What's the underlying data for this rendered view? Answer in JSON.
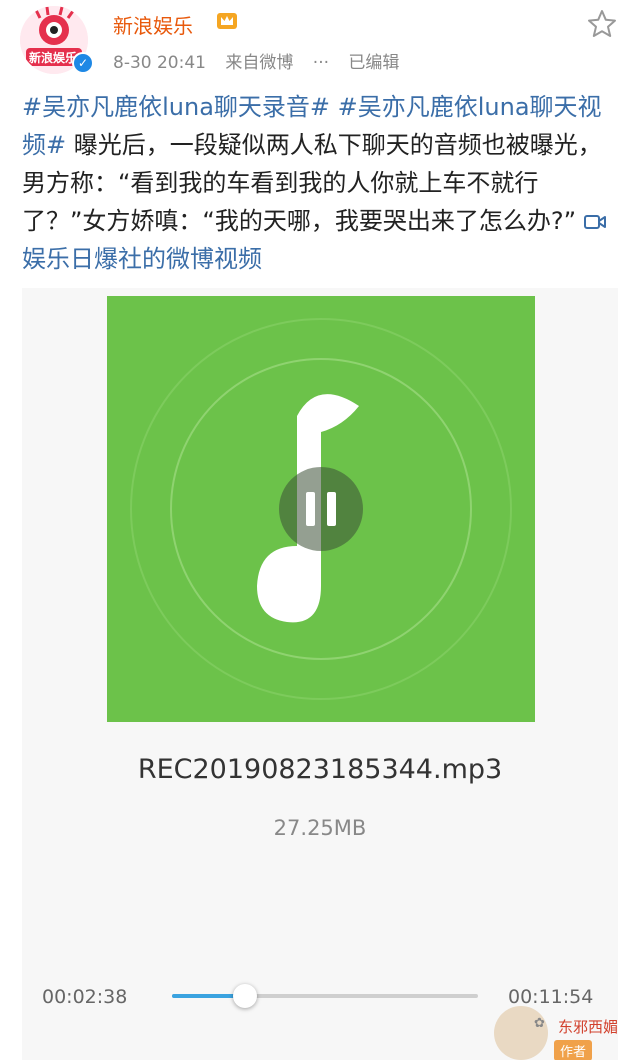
{
  "post": {
    "author": "新浪娱乐",
    "avatar_text": "新浪娱乐",
    "date": "8-30 20:41",
    "source": "来自微博",
    "dots": "···",
    "edited": "已编辑",
    "hashtag1": "#吴亦凡鹿依luna聊天录音#",
    "hashtag2": "#吴亦凡鹿依luna聊天视频#",
    "body": "曝光后，一段疑似两人私下聊天的音频也被曝光，男方称：“看到我的车看到我的人你就上车不就行了？”女方娇嗔：“我的天哪，我要哭出来了怎么办?”",
    "video_link": "娱乐日爆社的微博视频"
  },
  "player": {
    "filename": "REC20190823185344.mp3",
    "filesize": "27.25MB",
    "current_time": "00:02:38",
    "total_time": "00:11:54",
    "progress": 0.24,
    "cover_color": "#6cc24a",
    "accent": "#3aa3e0"
  },
  "watermark": {
    "text": "东邪西媚",
    "label": "作者"
  },
  "icons": {
    "star": "star-icon",
    "verified": "verified-icon",
    "crown": "crown-icon",
    "video": "video-camera-icon",
    "music_note": "music-note-icon",
    "pause": "pause-icon"
  }
}
